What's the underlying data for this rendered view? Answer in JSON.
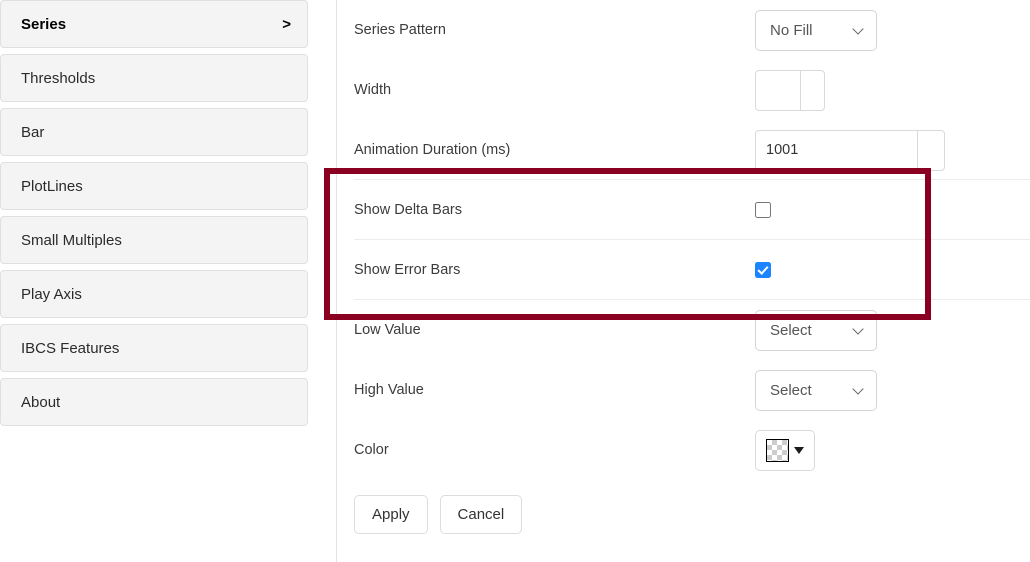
{
  "sidebar": {
    "items": [
      {
        "label": "Series",
        "active": true,
        "chevron": ">",
        "chevron_icon": "chevron-right-icon"
      },
      {
        "label": "Thresholds",
        "active": false
      },
      {
        "label": "Bar",
        "active": false
      },
      {
        "label": "PlotLines",
        "active": false
      },
      {
        "label": "Small Multiples",
        "active": false
      },
      {
        "label": "Play Axis",
        "active": false
      },
      {
        "label": "IBCS Features",
        "active": false
      },
      {
        "label": "About",
        "active": false
      }
    ]
  },
  "panel": {
    "rows": [
      {
        "label": "Series Pattern",
        "control": "select",
        "value": "No Fill"
      },
      {
        "label": "Width",
        "control": "number",
        "value": ""
      },
      {
        "label": "Animation Duration (ms)",
        "control": "number",
        "value": "1001"
      },
      {
        "label": "Show Delta Bars",
        "control": "checkbox",
        "checked": false
      },
      {
        "label": "Show Error Bars",
        "control": "checkbox",
        "checked": true
      },
      {
        "label": "Low Value",
        "control": "select",
        "value": "Select"
      },
      {
        "label": "High Value",
        "control": "select",
        "value": "Select"
      },
      {
        "label": "Color",
        "control": "color",
        "value": "transparent"
      }
    ],
    "buttons": {
      "apply_label": "Apply",
      "cancel_label": "Cancel"
    }
  },
  "highlight": {
    "color": "#8b0020"
  }
}
